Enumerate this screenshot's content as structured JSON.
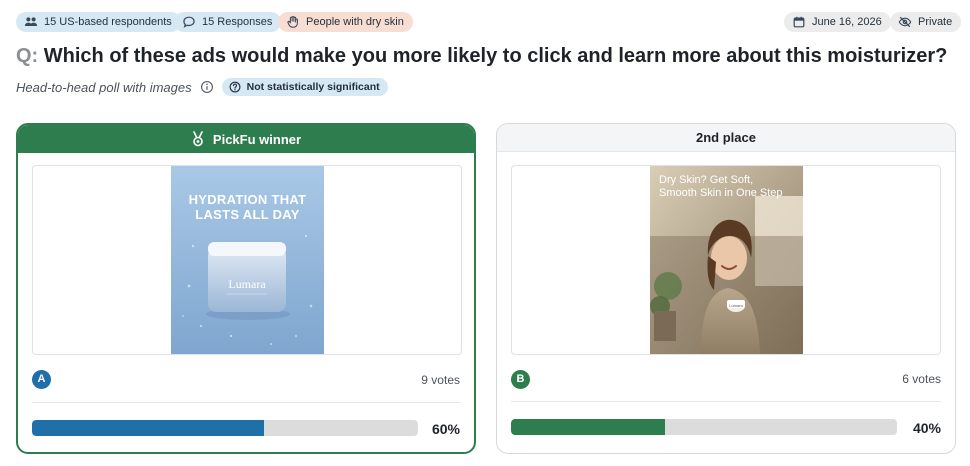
{
  "tags": {
    "respondents": "15 US-based respondents",
    "responses": "15 Responses",
    "audience": "People with dry skin",
    "date": "June 16, 2026",
    "privacy": "Private"
  },
  "question": {
    "prefix": "Q:",
    "text": "Which of these ads would make you more likely to click and learn more about this moisturizer?"
  },
  "poll": {
    "type": "Head-to-head poll with images",
    "significance": "Not statistically significant"
  },
  "options": [
    {
      "header": "PickFu winner",
      "letter": "A",
      "votes": "9 votes",
      "percent": "60%",
      "share": 0.6,
      "ad_headline_1": "HYDRATION THAT",
      "ad_headline_2": "LASTS ALL DAY",
      "brand": "Lumara"
    },
    {
      "header": "2nd place",
      "letter": "B",
      "votes": "6 votes",
      "percent": "40%",
      "share": 0.4,
      "ad_headline_1": "Dry Skin? Get Soft,",
      "ad_headline_2": "Smooth Skin in One Step",
      "brand": "Lumara"
    }
  ],
  "colors": {
    "winner_green": "#2e7d4f",
    "option_a_blue": "#1f6fa8",
    "tag_blue": "#d7e8f5",
    "tag_peach": "#f8ddd3"
  },
  "icons": [
    "people-icon",
    "chat-icon",
    "hand-icon",
    "calendar-icon",
    "eye-off-icon",
    "info-icon",
    "question-icon",
    "medal-icon"
  ]
}
